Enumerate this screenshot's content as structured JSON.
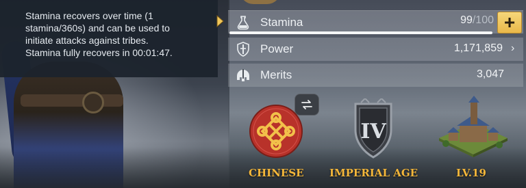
{
  "tooltip": {
    "text": "Stamina recovers over time (1\nstamina/360s) and can be used to\ninitiate attacks against tribes.\nStamina fully recovers in 00:01:47."
  },
  "stats": {
    "stamina": {
      "label": "Stamina",
      "current": "99",
      "max": "/100",
      "fill": 0.99,
      "icon": "flask-icon",
      "add_label": "+"
    },
    "power": {
      "label": "Power",
      "value": "1,171,859",
      "icon": "sword-shield-icon"
    },
    "merits": {
      "label": "Merits",
      "value": "3,047",
      "icon": "helmet-icon"
    }
  },
  "emblems": {
    "civilization": {
      "label": "CHINESE",
      "icon": "chinese-knot-icon"
    },
    "age": {
      "label": "IMPERIAL AGE",
      "icon": "roman-numeral-four-shield-icon"
    },
    "city": {
      "label": "LV.19",
      "icon": "castle-icon"
    }
  },
  "swap_icon": "swap-arrows-icon",
  "colors": {
    "accent_gold": "#f5b73a",
    "button_gold": "#e9b84a",
    "tooltip_bg": "#1c232d",
    "emblem_red": "#b8322a"
  }
}
